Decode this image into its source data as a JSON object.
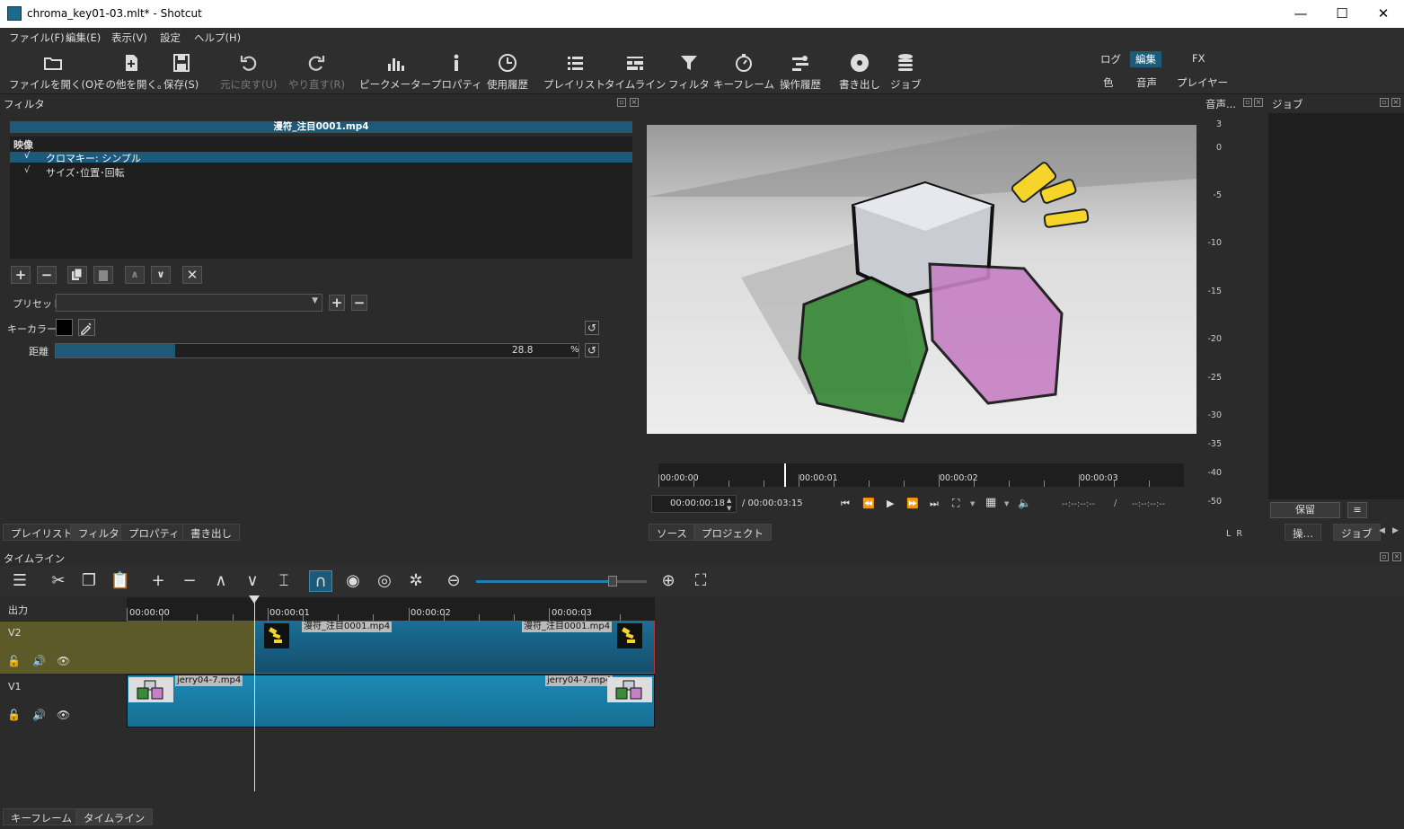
{
  "window": {
    "title": "chroma_key01-03.mlt* - Shotcut",
    "minimize": "—",
    "maximize": "☐",
    "close": "✕"
  },
  "menu": [
    "ファイル(F)",
    "編集(E)",
    "表示(V)",
    "設定",
    "ヘルプ(H)"
  ],
  "toolbar": {
    "open_file": "ファイルを開く(O)",
    "open_other": "その他を開く。",
    "save": "保存(S)",
    "undo": "元に戻す(U)",
    "redo": "やり直す(R)",
    "peak_meter": "ピークメーター",
    "properties": "プロパティ",
    "history": "使用履歴",
    "playlist": "プレイリスト",
    "timeline": "タイムライン",
    "filters": "フィルタ",
    "keyframes": "キーフレーム",
    "action_history": "操作履歴",
    "export": "書き出し",
    "jobs": "ジョブ"
  },
  "workspaces": {
    "log": "ログ",
    "edit": "編集",
    "fx": "FX",
    "color": "色",
    "audio": "音声",
    "player": "プレイヤー"
  },
  "filters_panel": {
    "title": "フィルタ",
    "clip_name": "漫符_注目0001.mp4",
    "section": "映像",
    "items": [
      {
        "check": "√",
        "label": "クロマキー: シンプル",
        "selected": true
      },
      {
        "check": "√",
        "label": "サイズ･位置･回転",
        "selected": false
      }
    ],
    "preset_label": "プリセット",
    "preset_value": "",
    "key_color_label": "キーカラー",
    "key_color": "#000000",
    "distance_label": "距離",
    "distance_value": "28.8",
    "distance_unit": "%",
    "distance_fraction": 0.228
  },
  "left_tabs": [
    "プレイリスト",
    "フィルタ",
    "プロパティ",
    "書き出し"
  ],
  "player": {
    "ruler_labels": [
      "00:00:00",
      "00:00:01",
      "00:00:02",
      "00:00:03"
    ],
    "position": "00:00:00:18",
    "duration": "/ 00:00:03:15",
    "in_point": "--:--:--:--",
    "sep": "/",
    "out_point": "--:--:--:--",
    "tabs": [
      "ソース",
      "プロジェクト"
    ],
    "playhead_fraction": 0.24
  },
  "audio_meter": {
    "title": "音声...",
    "scale": [
      "3",
      "0",
      "-5",
      "-10",
      "-15",
      "-20",
      "-25",
      "-30",
      "-35",
      "-40",
      "-50"
    ],
    "lr": "L  R"
  },
  "jobs_panel": {
    "title": "ジョブ",
    "hold_button": "保留",
    "menu_icon": "≡",
    "tab1": "操…",
    "tab2": "ジョブ"
  },
  "timeline": {
    "title": "タイムライン",
    "output_label": "出力",
    "ruler_labels": [
      "00:00:00",
      "00:00:01",
      "00:00:02",
      "00:00:03"
    ],
    "tracks": [
      {
        "name": "V2",
        "clip_label_start": "漫符_注目0001.mp4",
        "clip_label_end": "漫符_注目0001.mp4"
      },
      {
        "name": "V1",
        "clip_label_start": "jerry04-7.mp4",
        "clip_label_end": "jerry04-7.mp4"
      }
    ],
    "zoom_fraction": 0.8
  },
  "bottom_tabs": [
    "キーフレーム",
    "タイムライン"
  ],
  "colors": {
    "accent": "#1d5a78",
    "selected_row": "#1d5a78",
    "v2_track": "#5b5a28",
    "clip_blue": "#1b8ab5",
    "window_bg": "#2b2b2b"
  }
}
